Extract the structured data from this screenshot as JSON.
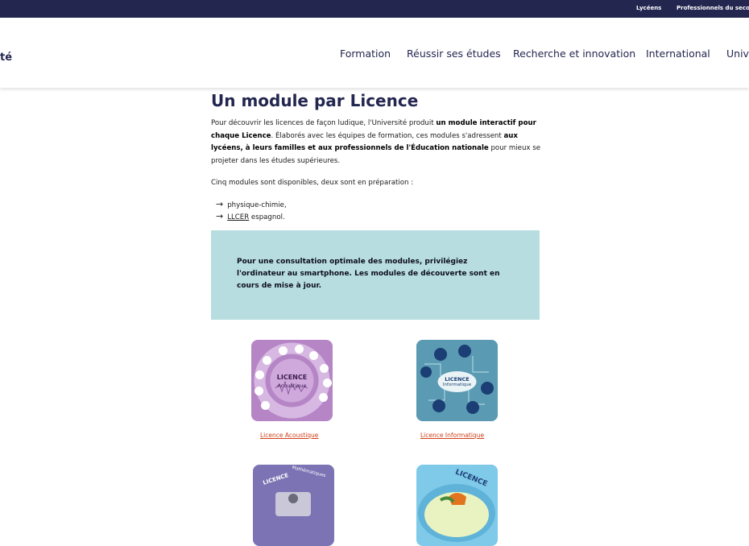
{
  "topbar": {
    "links": [
      "Lycéens",
      "Professionnels du seco"
    ]
  },
  "header": {
    "brand_fragment": "té",
    "nav": [
      "Formation",
      "Réussir ses études",
      "Recherche et innovation",
      "International",
      "Univ"
    ]
  },
  "main": {
    "title": "Un module par Licence",
    "intro": {
      "t1": "Pour découvrir les licences de façon ludique, l'Université produit ",
      "b1": "un module interactif pour chaque Licence",
      "t2": ". Élaborés avec les équipes de formation, ces modules s'adressent ",
      "b2": "aux lycéens, à leurs familles et aux professionnels de l'Éducation nationale",
      "t3": " pour mieux se projeter dans les études supérieures."
    },
    "availability": "Cinq modules sont disponibles, deux sont en préparation :",
    "prep_list": {
      "arrow": "→",
      "item1": "physique-chimie,",
      "item2_abbr": "LLCER",
      "item2_rest": " espagnol."
    },
    "notice": "Pour une consultation optimale des modules, privilégiez l'ordinateur au smartphone. Les modules de découverte sont en cours de mise à jour."
  },
  "modules": [
    {
      "badge_title": "LICENCE",
      "badge_sub": "Acoustique",
      "link": "Licence Acoustique",
      "color": "#b07fc0"
    },
    {
      "badge_title": "LICENCE",
      "badge_sub": "Informatique",
      "link": "Licence Informatique",
      "color": "#4e8fa8"
    },
    {
      "badge_title": "LICENCE",
      "badge_sub": "Mathématiques",
      "color": "#7b73b3"
    },
    {
      "badge_title": "LICENCE",
      "color": "#7ec8e8"
    }
  ],
  "colors": {
    "navy": "#23264f",
    "notice_bg": "#b7dde0",
    "link": "#d0401a"
  }
}
